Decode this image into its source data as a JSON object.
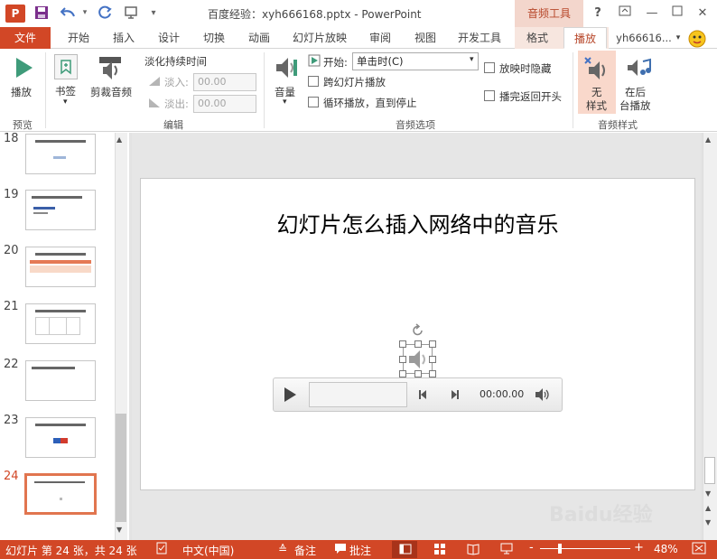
{
  "window": {
    "title": "百度经验：xyh666168.pptx - PowerPoint",
    "context_tab_group": "音频工具",
    "help": "?",
    "logo": "P"
  },
  "tabs": [
    {
      "label": "文件"
    },
    {
      "label": "开始"
    },
    {
      "label": "插入"
    },
    {
      "label": "设计"
    },
    {
      "label": "切换"
    },
    {
      "label": "动画"
    },
    {
      "label": "幻灯片放映"
    },
    {
      "label": "审阅"
    },
    {
      "label": "视图"
    },
    {
      "label": "开发工具"
    },
    {
      "label": "格式"
    },
    {
      "label": "播放"
    }
  ],
  "user": "yh66616...",
  "ribbon": {
    "preview": {
      "play": "播放",
      "group": "预览"
    },
    "bookmarks": {
      "bookmark": "书签",
      "group": "书签"
    },
    "edit": {
      "trim": "剪裁音频",
      "fade_title": "淡化持续时间",
      "fade_in": "淡入:",
      "fade_in_val": "00.00",
      "fade_out": "淡出:",
      "fade_out_val": "00.00",
      "group": "编辑"
    },
    "audio_options": {
      "volume": "音量",
      "start_label": "开始:",
      "start_value": "单击时(C)",
      "cross": "跨幻灯片播放",
      "loop": "循环播放，直到停止",
      "hide": "放映时隐藏",
      "rewind": "播完返回开头",
      "group": "音频选项"
    },
    "audio_styles": {
      "no_style_1": "无",
      "no_style_2": "样式",
      "bg_1": "在后",
      "bg_2": "台播放",
      "group": "音频样式"
    }
  },
  "slides": [
    {
      "num": "18"
    },
    {
      "num": "19"
    },
    {
      "num": "20"
    },
    {
      "num": "21"
    },
    {
      "num": "22"
    },
    {
      "num": "23"
    },
    {
      "num": "24"
    }
  ],
  "slide": {
    "title": "幻灯片怎么插入网络中的音乐"
  },
  "player": {
    "time": "00:00.00"
  },
  "status": {
    "slide_info": "幻灯片 第 24 张，共 24 张",
    "lang": "中文(中国)",
    "notes": "备注",
    "comments": "批注",
    "zoom": "48%",
    "minus": "-",
    "plus": "+"
  },
  "watermark": "Baidu经验"
}
